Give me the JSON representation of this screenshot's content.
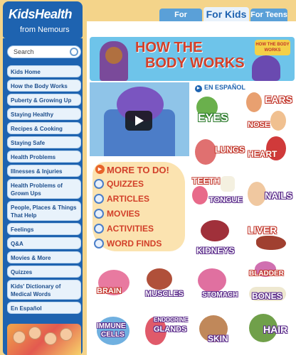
{
  "brand": {
    "name": "KidsHealth",
    "subtitle": "from Nemours"
  },
  "tabs": [
    {
      "label": "For Parents",
      "active": false
    },
    {
      "label": "For Kids",
      "active": true
    },
    {
      "label": "For Teens",
      "active": false
    }
  ],
  "search": {
    "placeholder": "Search"
  },
  "sidebar": {
    "items": [
      {
        "label": "Kids Home"
      },
      {
        "label": "How the Body Works"
      },
      {
        "label": "Puberty & Growing Up"
      },
      {
        "label": "Staying Healthy"
      },
      {
        "label": "Recipes & Cooking"
      },
      {
        "label": "Staying Safe"
      },
      {
        "label": "Health Problems"
      },
      {
        "label": "Illnesses & Injuries"
      },
      {
        "label": "Health Problems of Grown Ups"
      },
      {
        "label": "People, Places & Things That Help"
      },
      {
        "label": "Feelings"
      },
      {
        "label": "Q&A"
      },
      {
        "label": "Movies & More"
      },
      {
        "label": "Quizzes"
      },
      {
        "label": "Kids' Dictionary of Medical Words"
      },
      {
        "label": "En Español"
      }
    ]
  },
  "hero": {
    "title_line1": "HOW THE",
    "title_line2": "BODY WORKS",
    "badge": "HOW THE BODY WORKS"
  },
  "espanol": {
    "label": "EN ESPAÑOL"
  },
  "more": {
    "heading": "MORE TO DO!",
    "items": [
      {
        "label": "QUIZZES",
        "icon": "question-icon"
      },
      {
        "label": "ARTICLES",
        "icon": "document-icon"
      },
      {
        "label": "MOVIES",
        "icon": "film-icon"
      },
      {
        "label": "ACTIVITIES",
        "icon": "puzzle-icon"
      },
      {
        "label": "WORD FINDS",
        "icon": "magnifier-icon"
      }
    ]
  },
  "topics": [
    {
      "label": "EYES",
      "color": "#2a9a3a"
    },
    {
      "label": "EARS",
      "color": "#c2362a"
    },
    {
      "label": "NOSE",
      "color": "#c2362a"
    },
    {
      "label": "LUNGS",
      "color": "#c2362a"
    },
    {
      "label": "HEART",
      "color": "#c2362a"
    },
    {
      "label": "TEETH",
      "color": "#c2362a"
    },
    {
      "label": "TONGUE",
      "color": "#5a2a8a"
    },
    {
      "label": "NAILS",
      "color": "#5a2a8a"
    },
    {
      "label": "KIDNEYS",
      "color": "#c2362a"
    },
    {
      "label": "LIVER",
      "color": "#c2362a"
    },
    {
      "label": "BRAIN",
      "color": "#c2362a"
    },
    {
      "label": "MUSCLES",
      "color": "#5a2a8a"
    },
    {
      "label": "STOMACH",
      "color": "#5a2a8a"
    },
    {
      "label": "BLADDER",
      "color": "#c2362a"
    },
    {
      "label": "BONES",
      "color": "#5a2a8a"
    },
    {
      "label": "IMMUNE",
      "color": "#5a2a8a"
    },
    {
      "label": "CELLS",
      "color": "#5a2a8a"
    },
    {
      "label": "ENDOCRINE",
      "color": "#5a2a8a"
    },
    {
      "label": "GLANDS",
      "color": "#5a2a8a"
    },
    {
      "label": "SKIN",
      "color": "#5a2a8a"
    },
    {
      "label": "HAIR",
      "color": "#5a2a8a"
    }
  ]
}
